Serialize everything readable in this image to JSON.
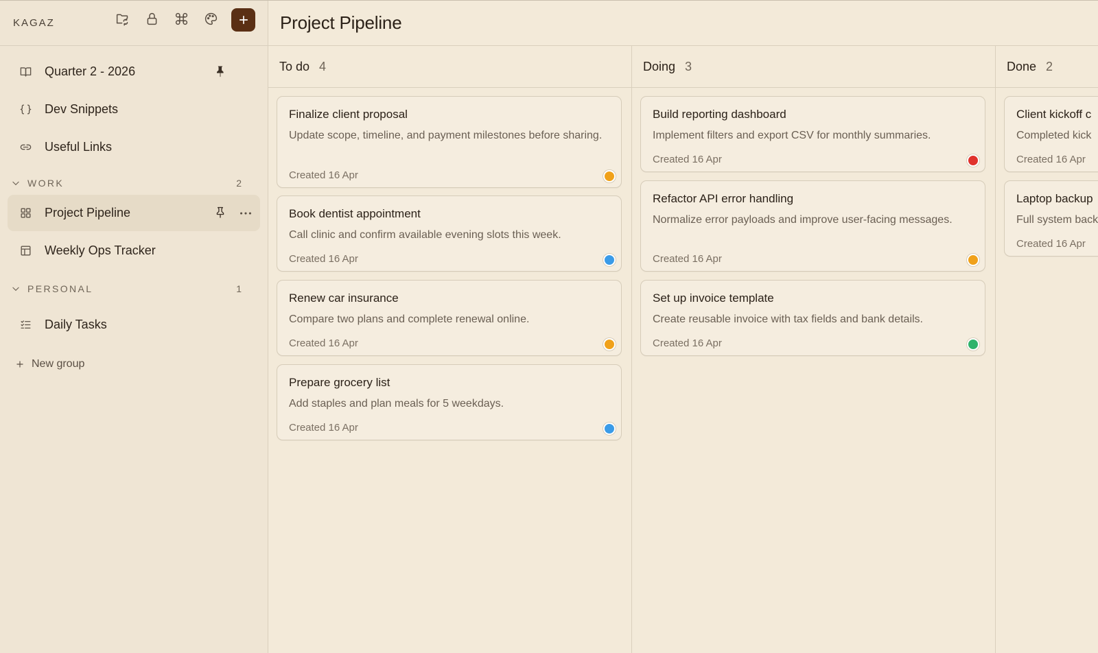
{
  "sidebar": {
    "brand": "KAGAZ",
    "top_icons": [
      "folder-sync-icon",
      "lock-icon",
      "command-icon",
      "palette-icon"
    ],
    "add_icon": "plus-icon",
    "items_top": [
      {
        "label": "Quarter 2 - 2026",
        "icon": "book-icon",
        "pinned": true
      },
      {
        "label": "Dev Snippets",
        "icon": "braces-icon"
      },
      {
        "label": "Useful Links",
        "icon": "link-icon"
      }
    ],
    "groups": [
      {
        "label": "WORK",
        "count": "2",
        "items": [
          {
            "label": "Project Pipeline",
            "icon": "grid-icon",
            "active": true
          },
          {
            "label": "Weekly Ops Tracker",
            "icon": "table-icon"
          }
        ]
      },
      {
        "label": "PERSONAL",
        "count": "1",
        "items": [
          {
            "label": "Daily Tasks",
            "icon": "checklist-icon"
          }
        ]
      }
    ],
    "new_group": "New group"
  },
  "main": {
    "title": "Project Pipeline",
    "columns": [
      {
        "name": "To do",
        "count": "4",
        "cards": [
          {
            "title": "Finalize client proposal",
            "desc": "Update scope, timeline, and payment milestones before sharing.",
            "date": "Created 16 Apr",
            "dot": "#f0a11a"
          },
          {
            "title": "Book dentist appointment",
            "desc": "Call clinic and confirm available evening slots this week.",
            "date": "Created 16 Apr",
            "dot": "#3a9be8"
          },
          {
            "title": "Renew car insurance",
            "desc": "Compare two plans and complete renewal online.",
            "date": "Created 16 Apr",
            "dot": "#f0a11a"
          },
          {
            "title": "Prepare grocery list",
            "desc": "Add staples and plan meals for 5 weekdays.",
            "date": "Created 16 Apr",
            "dot": "#3a9be8"
          }
        ]
      },
      {
        "name": "Doing",
        "count": "3",
        "cards": [
          {
            "title": "Build reporting dashboard",
            "desc": "Implement filters and export CSV for monthly summaries.",
            "date": "Created 16 Apr",
            "dot": "#e0322c"
          },
          {
            "title": "Refactor API error handling",
            "desc": "Normalize error payloads and improve user-facing messages.",
            "date": "Created 16 Apr",
            "dot": "#f0a11a"
          },
          {
            "title": "Set up invoice template",
            "desc": "Create reusable invoice with tax fields and bank details.",
            "date": "Created 16 Apr",
            "dot": "#2fb36b"
          }
        ]
      },
      {
        "name": "Done",
        "count": "2",
        "cards": [
          {
            "title": "Client kickoff c",
            "desc": "Completed kick",
            "date": "Created 16 Apr"
          },
          {
            "title": "Laptop backup",
            "desc": "Full system back",
            "date": "Created 16 Apr"
          }
        ]
      }
    ]
  }
}
